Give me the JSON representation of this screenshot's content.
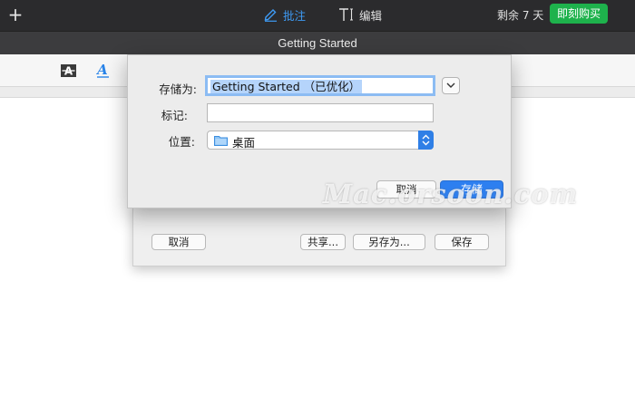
{
  "toolbar": {
    "annotate_label": "批注",
    "edit_label": "编辑",
    "trial_text": "剩余 7 天",
    "buy_label": "即刻购买",
    "accent_color": "#3e9bf5",
    "buy_color": "#1eb24c"
  },
  "document": {
    "title": "Getting Started"
  },
  "back_sheet": {
    "cancel_label": "取消",
    "share_label": "共享...",
    "save_as_label": "另存为...",
    "save_label": "保存"
  },
  "save_dialog": {
    "save_as_label": "存储为:",
    "file_name": "Getting Started （已优化）",
    "tags_label": "标记:",
    "tags_value": "",
    "where_label": "位置:",
    "where_value": "桌面",
    "cancel_label": "取消",
    "save_label": "存储"
  },
  "watermark": "Mac.orsoon.com"
}
